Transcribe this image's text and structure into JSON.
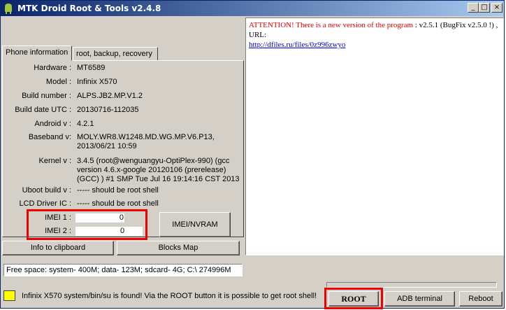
{
  "window": {
    "title": "MTK Droid Root & Tools v2.4.8",
    "icon": "android-icon",
    "controls": {
      "minimize": "_",
      "maximize": "□",
      "close": "×"
    }
  },
  "tabs": [
    {
      "label": "Phone information",
      "active": true
    },
    {
      "label": "root, backup, recovery",
      "active": false
    }
  ],
  "phone_info": {
    "hardware": {
      "label": "Hardware :",
      "value": "MT6589"
    },
    "model": {
      "label": "Model :",
      "value": "Infinix X570"
    },
    "build_number": {
      "label": "Build number :",
      "value": "ALPS.JB2.MP.V1.2"
    },
    "build_date": {
      "label": "Build date UTC :",
      "value": "20130716-112035"
    },
    "android": {
      "label": "Android  v :",
      "value": "4.2.1"
    },
    "baseband": {
      "label": "Baseband v:",
      "value": "MOLY.WR8.W1248.MD.WG.MP.V6.P13, 2013/06/21 10:59"
    },
    "kernel": {
      "label": "Kernel v :",
      "value": "3.4.5 (root@wenguangyu-OptiPlex-990) (gcc version 4.6.x-google 20120106 (prerelease) (GCC) ) #1 SMP  Tue Jul 16 19:14:16 CST 2013"
    },
    "uboot": {
      "label": "Uboot build v :",
      "value": "----- should be  root shell"
    },
    "lcd": {
      "label": "LCD Driver IC :",
      "value": "----- should be  root shell"
    },
    "imei1": {
      "label": "IMEI 1 :",
      "value": "0"
    },
    "imei2": {
      "label": "IMEI 2 :",
      "value": "0"
    }
  },
  "buttons": {
    "imei_nvram": "IMEI/NVRAM",
    "info_clipboard": "Info to clipboard",
    "blocks_map": "Blocks Map",
    "root": "ROOT",
    "adb_terminal": "ADB terminal",
    "reboot": "Reboot"
  },
  "free_space": "Free space: system- 400M; data- 123M; sdcard- 4G;  C:\\ 274996M",
  "log": {
    "attention": "ATTENTION!  There is a new version of the program",
    "rest": " : v2.5.1 (BugFix v2.5.0 !) , URL:",
    "url": "http://dfiles.ru/files/0z996zwyo"
  },
  "status": {
    "color": "#ffff00",
    "text": "Infinix X570 system/bin/su is found! Via the ROOT button it is possible to get root shell!"
  }
}
